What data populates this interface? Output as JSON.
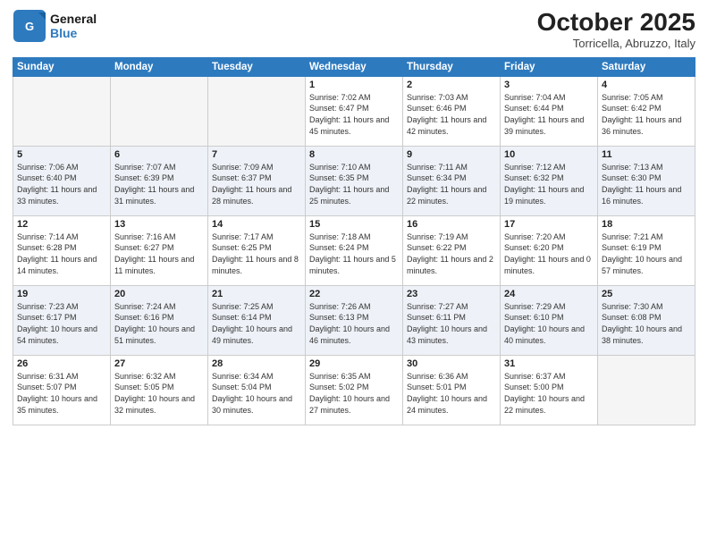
{
  "header": {
    "logo_line1": "General",
    "logo_line2": "Blue",
    "month": "October 2025",
    "location": "Torricella, Abruzzo, Italy"
  },
  "weekdays": [
    "Sunday",
    "Monday",
    "Tuesday",
    "Wednesday",
    "Thursday",
    "Friday",
    "Saturday"
  ],
  "weeks": [
    [
      {
        "day": "",
        "info": ""
      },
      {
        "day": "",
        "info": ""
      },
      {
        "day": "",
        "info": ""
      },
      {
        "day": "1",
        "info": "Sunrise: 7:02 AM\nSunset: 6:47 PM\nDaylight: 11 hours and 45 minutes."
      },
      {
        "day": "2",
        "info": "Sunrise: 7:03 AM\nSunset: 6:46 PM\nDaylight: 11 hours and 42 minutes."
      },
      {
        "day": "3",
        "info": "Sunrise: 7:04 AM\nSunset: 6:44 PM\nDaylight: 11 hours and 39 minutes."
      },
      {
        "day": "4",
        "info": "Sunrise: 7:05 AM\nSunset: 6:42 PM\nDaylight: 11 hours and 36 minutes."
      }
    ],
    [
      {
        "day": "5",
        "info": "Sunrise: 7:06 AM\nSunset: 6:40 PM\nDaylight: 11 hours and 33 minutes."
      },
      {
        "day": "6",
        "info": "Sunrise: 7:07 AM\nSunset: 6:39 PM\nDaylight: 11 hours and 31 minutes."
      },
      {
        "day": "7",
        "info": "Sunrise: 7:09 AM\nSunset: 6:37 PM\nDaylight: 11 hours and 28 minutes."
      },
      {
        "day": "8",
        "info": "Sunrise: 7:10 AM\nSunset: 6:35 PM\nDaylight: 11 hours and 25 minutes."
      },
      {
        "day": "9",
        "info": "Sunrise: 7:11 AM\nSunset: 6:34 PM\nDaylight: 11 hours and 22 minutes."
      },
      {
        "day": "10",
        "info": "Sunrise: 7:12 AM\nSunset: 6:32 PM\nDaylight: 11 hours and 19 minutes."
      },
      {
        "day": "11",
        "info": "Sunrise: 7:13 AM\nSunset: 6:30 PM\nDaylight: 11 hours and 16 minutes."
      }
    ],
    [
      {
        "day": "12",
        "info": "Sunrise: 7:14 AM\nSunset: 6:28 PM\nDaylight: 11 hours and 14 minutes."
      },
      {
        "day": "13",
        "info": "Sunrise: 7:16 AM\nSunset: 6:27 PM\nDaylight: 11 hours and 11 minutes."
      },
      {
        "day": "14",
        "info": "Sunrise: 7:17 AM\nSunset: 6:25 PM\nDaylight: 11 hours and 8 minutes."
      },
      {
        "day": "15",
        "info": "Sunrise: 7:18 AM\nSunset: 6:24 PM\nDaylight: 11 hours and 5 minutes."
      },
      {
        "day": "16",
        "info": "Sunrise: 7:19 AM\nSunset: 6:22 PM\nDaylight: 11 hours and 2 minutes."
      },
      {
        "day": "17",
        "info": "Sunrise: 7:20 AM\nSunset: 6:20 PM\nDaylight: 11 hours and 0 minutes."
      },
      {
        "day": "18",
        "info": "Sunrise: 7:21 AM\nSunset: 6:19 PM\nDaylight: 10 hours and 57 minutes."
      }
    ],
    [
      {
        "day": "19",
        "info": "Sunrise: 7:23 AM\nSunset: 6:17 PM\nDaylight: 10 hours and 54 minutes."
      },
      {
        "day": "20",
        "info": "Sunrise: 7:24 AM\nSunset: 6:16 PM\nDaylight: 10 hours and 51 minutes."
      },
      {
        "day": "21",
        "info": "Sunrise: 7:25 AM\nSunset: 6:14 PM\nDaylight: 10 hours and 49 minutes."
      },
      {
        "day": "22",
        "info": "Sunrise: 7:26 AM\nSunset: 6:13 PM\nDaylight: 10 hours and 46 minutes."
      },
      {
        "day": "23",
        "info": "Sunrise: 7:27 AM\nSunset: 6:11 PM\nDaylight: 10 hours and 43 minutes."
      },
      {
        "day": "24",
        "info": "Sunrise: 7:29 AM\nSunset: 6:10 PM\nDaylight: 10 hours and 40 minutes."
      },
      {
        "day": "25",
        "info": "Sunrise: 7:30 AM\nSunset: 6:08 PM\nDaylight: 10 hours and 38 minutes."
      }
    ],
    [
      {
        "day": "26",
        "info": "Sunrise: 6:31 AM\nSunset: 5:07 PM\nDaylight: 10 hours and 35 minutes."
      },
      {
        "day": "27",
        "info": "Sunrise: 6:32 AM\nSunset: 5:05 PM\nDaylight: 10 hours and 32 minutes."
      },
      {
        "day": "28",
        "info": "Sunrise: 6:34 AM\nSunset: 5:04 PM\nDaylight: 10 hours and 30 minutes."
      },
      {
        "day": "29",
        "info": "Sunrise: 6:35 AM\nSunset: 5:02 PM\nDaylight: 10 hours and 27 minutes."
      },
      {
        "day": "30",
        "info": "Sunrise: 6:36 AM\nSunset: 5:01 PM\nDaylight: 10 hours and 24 minutes."
      },
      {
        "day": "31",
        "info": "Sunrise: 6:37 AM\nSunset: 5:00 PM\nDaylight: 10 hours and 22 minutes."
      },
      {
        "day": "",
        "info": ""
      }
    ]
  ]
}
